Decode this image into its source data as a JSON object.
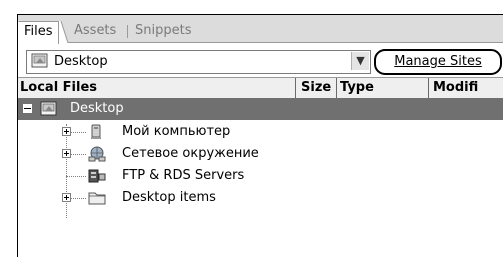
{
  "tabs": [
    {
      "label": "Files",
      "active": true
    },
    {
      "label": "Assets",
      "active": false
    },
    {
      "label": "Snippets",
      "active": false
    }
  ],
  "site_selector": {
    "value": "Desktop",
    "icon": "desktop-icon"
  },
  "manage_sites_label": "Manage Sites",
  "columns": [
    "Local Files",
    "Size",
    "Type",
    "Modifi"
  ],
  "tree": [
    {
      "label": "Desktop",
      "icon": "desktop-icon",
      "expander": "minus",
      "selected": true
    },
    {
      "label": "Мой компьютер",
      "icon": "my-computer-icon",
      "expander": "plus"
    },
    {
      "label": "Сетевое окружение",
      "icon": "network-places-icon",
      "expander": "plus"
    },
    {
      "label": "FTP & RDS Servers",
      "icon": "ftp-rds-servers-icon",
      "expander": "none"
    },
    {
      "label": "Desktop items",
      "icon": "folder-icon",
      "expander": "plus"
    }
  ],
  "colors": {
    "selection": "#707070",
    "tab_bar": "#dcdcdc",
    "header": "#efefef"
  }
}
